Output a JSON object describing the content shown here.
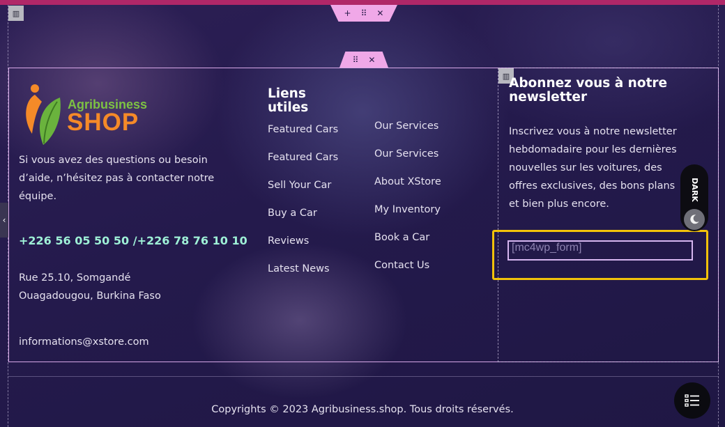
{
  "colors": {
    "top_bar": "#b02768",
    "phone": "#9ef0d6",
    "handle": "#f0a8e8",
    "highlight": "#f2c20a",
    "logo_green": "#7dc243",
    "logo_orange": "#f58a28"
  },
  "editor": {
    "section_add_icon": "+",
    "section_drag_icon": "⠿",
    "section_close_icon": "✕",
    "inner_drag_icon": "⠿",
    "inner_close_icon": "✕",
    "column_icon": "▥",
    "side_tab_icon": "‹"
  },
  "brand": {
    "name_top": "Agribusiness",
    "name_bottom": "SHOP"
  },
  "contact": {
    "description": "Si vous avez des questions ou besoin d’aide, n’hésitez pas à contacter notre équipe.",
    "phone": "+226 56 05 50 50 /+226 78 76 10 10",
    "address": "Rue 25.10, Somgandé Ouagadougou, Burkina Faso",
    "email": "informations@xstore.com"
  },
  "links": {
    "heading": "Liens utiles",
    "col1": [
      "Featured Cars",
      "Featured Cars",
      "Sell Your Car",
      "Buy a Car",
      "Reviews",
      "Latest News"
    ],
    "col2": [
      "Our Services",
      "Our Services",
      "About XStore",
      "My Inventory",
      "Book a Car",
      "Contact Us"
    ]
  },
  "newsletter": {
    "heading": "Abonnez vous à notre newsletter",
    "description": "Inscrivez vous à notre newsletter hebdomadaire pour les dernières nouvelles sur les voitures, des offres exclusives, des bons plans et bien plus encore.",
    "form_shortcode": "[mc4wp_form]"
  },
  "theme_toggle": {
    "label": "DARK",
    "icon": "moon-icon"
  },
  "footer": {
    "copyright": "Copyrights © 2023 Agribusiness.shop. Tous droits réservés."
  }
}
